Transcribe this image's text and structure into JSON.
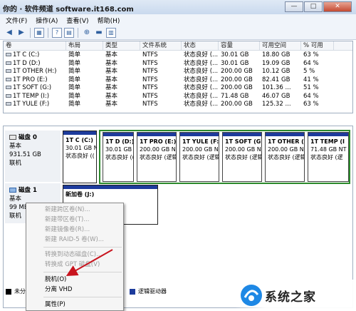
{
  "watermark": "你的 · 软件频道 software.it168.com",
  "window_buttons": {
    "minimize": "—",
    "maximize": "□",
    "close": "✕"
  },
  "menu": [
    "文件(F)",
    "操作(A)",
    "查看(V)",
    "帮助(H)"
  ],
  "toolbar": [
    "back-icon",
    "forward-icon",
    "console-icon",
    "help-icon",
    "properties-icon",
    "help2-icon",
    "disk-icon",
    "view-icon"
  ],
  "volume_list": {
    "columns": [
      "卷",
      "布局",
      "类型",
      "文件系统",
      "状态",
      "容量",
      "可用空间",
      "% 可用"
    ],
    "rows": [
      [
        "1T C (C:)",
        "简单",
        "基本",
        "NTFS",
        "状态良好 (...",
        "30.01 GB",
        "18.80 GB",
        "63 %"
      ],
      [
        "1T D (D:)",
        "简单",
        "基本",
        "NTFS",
        "状态良好 (...",
        "30.01 GB",
        "19.09 GB",
        "64 %"
      ],
      [
        "1T OTHER (H:)",
        "简单",
        "基本",
        "NTFS",
        "状态良好 (...",
        "200.00 GB",
        "10.12 GB",
        "5 %"
      ],
      [
        "1T PRO (E:)",
        "简单",
        "基本",
        "NTFS",
        "状态良好 (...",
        "200.00 GB",
        "82.41 GB",
        "41 %"
      ],
      [
        "1T SOFT (G:)",
        "简单",
        "基本",
        "NTFS",
        "状态良好 (...",
        "200.00 GB",
        "101.36 ...",
        "51 %"
      ],
      [
        "1T TEMP (I:)",
        "简单",
        "基本",
        "NTFS",
        "状态良好 (...",
        "71.48 GB",
        "46.07 GB",
        "64 %"
      ],
      [
        "1T YULE (F:)",
        "简单",
        "基本",
        "NTFS",
        "状态良好 (...",
        "200.00 GB",
        "125.32 ...",
        "63 %"
      ]
    ]
  },
  "disk0": {
    "name": "磁盘 0",
    "type": "基本",
    "size": "931.51 GB",
    "status": "联机",
    "partitions": [
      {
        "name": "1T C  (C:)",
        "size": "30.01 GB N",
        "status": "状态良好 (("
      },
      {
        "name": "1T D  (D:)",
        "size": "30.01 GB N",
        "status": "状态良好 (("
      },
      {
        "name": "1T PRO  (E:)",
        "size": "200.00 GB N",
        "status": "状态良好 (逻辑"
      },
      {
        "name": "1T YULE  (F:)",
        "size": "200.00 GB N",
        "status": "状态良好 (逻辑"
      },
      {
        "name": "1T SOFT  (G",
        "size": "200.00 GB N",
        "status": "状态良好 (逻辑"
      },
      {
        "name": "1T OTHER  (",
        "size": "200.00 GB N",
        "status": "状态良好 (逻辑"
      },
      {
        "name": "1T TEMP  (I",
        "size": "71.48 GB NT",
        "status": "状态良好 (逻"
      }
    ]
  },
  "disk1": {
    "name": "磁盘 1",
    "type": "基本",
    "size": "99 MB",
    "status": "联机",
    "partition": {
      "name": "新加卷 (J:)"
    }
  },
  "context_menu": {
    "items": [
      {
        "label": "新建跨区卷(N)...",
        "enabled": false
      },
      {
        "label": "新建带区卷(T)...",
        "enabled": false
      },
      {
        "label": "新建镜像卷(R)...",
        "enabled": false
      },
      {
        "label": "新建 RAID-5 卷(W)...",
        "enabled": false
      },
      {
        "sep": true
      },
      {
        "label": "转换到动态磁盘(C)...",
        "enabled": false
      },
      {
        "label": "转换成 GPT 磁盘(V)",
        "enabled": false
      },
      {
        "sep": true
      },
      {
        "label": "脱机(O)",
        "enabled": true
      },
      {
        "label": "分离 VHD",
        "enabled": true
      },
      {
        "sep": true
      },
      {
        "label": "属性(P)",
        "enabled": true
      }
    ]
  },
  "legend": [
    {
      "label": "未分",
      "color": "#000000"
    },
    {
      "label": "逻辑驱动器",
      "color": "#1d3b9c"
    }
  ],
  "logo": "系统之家",
  "colors": {
    "primary_partition": "#1d3b9c",
    "extended_border": "#2c8a2c",
    "unallocated": "#000000"
  }
}
